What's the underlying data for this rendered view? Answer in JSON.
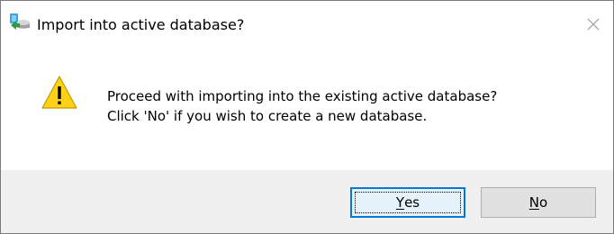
{
  "window": {
    "title": "Import into active database?",
    "close_glyph": "✕"
  },
  "message": {
    "line1": "Proceed with importing into the existing active database?",
    "line2": "Click 'No' if you wish to create a new database."
  },
  "buttons": {
    "yes_label": "Yes",
    "no_label": "No"
  },
  "icons": {
    "app": "database-app-icon",
    "warning": "warning-icon",
    "close": "close-icon"
  },
  "colors": {
    "footer_bg": "#f0f0f0",
    "default_button_border": "#0078d7",
    "warning_fill": "#fcd116"
  }
}
